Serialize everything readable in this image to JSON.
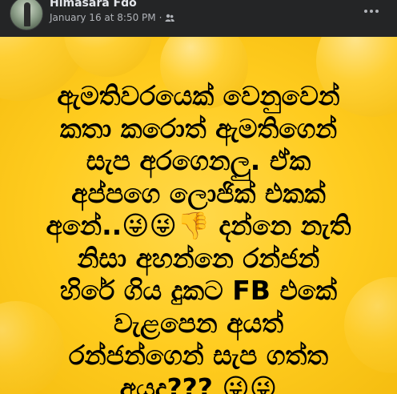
{
  "post": {
    "author": "Himasara Fdo",
    "timestamp": "January 16 at 8:50 PM",
    "separator": "·",
    "audience_icon": "friends-icon",
    "more_icon": "more-dots-icon"
  },
  "image_text": {
    "lines": [
      "ඇමතිවරයෙක් වෙනුවෙන්",
      "කතා කරොත් ඇමතිගෙන්",
      "සැප අරගෙනලු. ඒක",
      "අප්පගෙ ලොජික් එකක්",
      "අනේ..😜😜👎 දන්නෙ නැති",
      "නිසා අහන්නෙ රන්ජන්",
      "හිරේ ගිය දුකට FB එකේ",
      "වැළපෙන අයත්",
      "රන්ජන්ගෙන් සැප ගත්ත",
      "අයද??? 😜😜"
    ]
  },
  "colors": {
    "header_bg": "#242526",
    "image_bg": "#ffcc1f",
    "text": "#000000"
  }
}
